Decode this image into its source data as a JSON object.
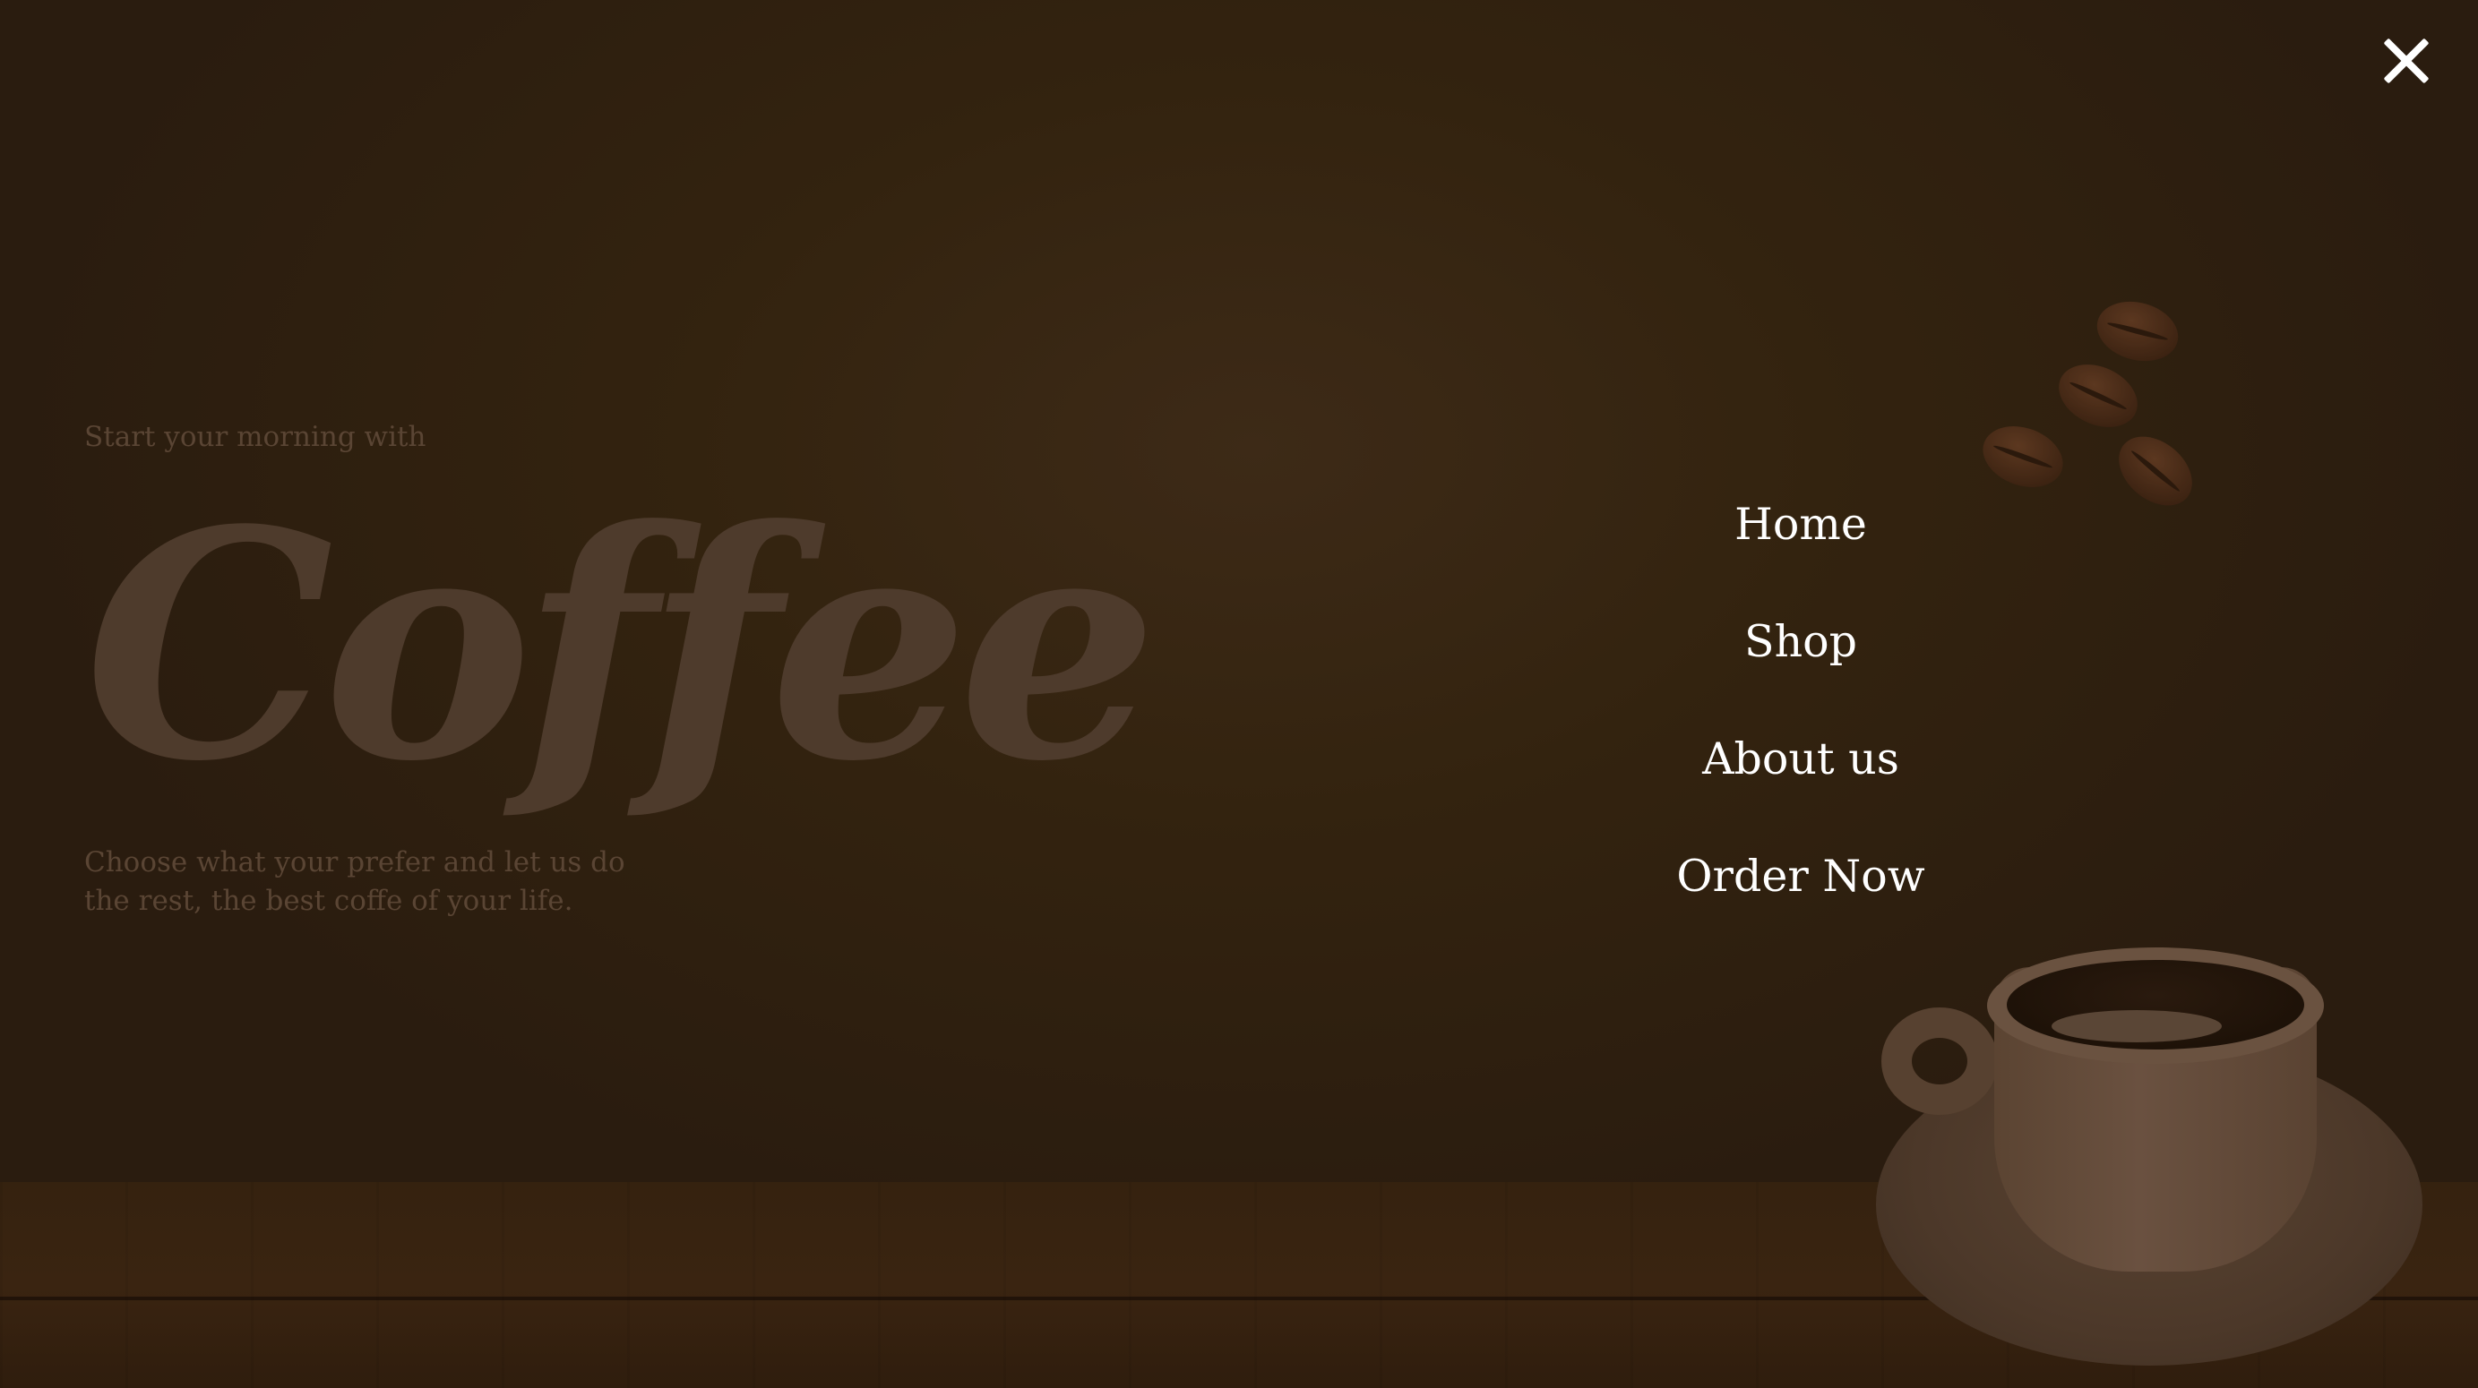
{
  "hero": {
    "kicker": "Start your morning with",
    "title": "Coffee",
    "description": "Choose what your prefer and let us do the rest, the best coffe of your life."
  },
  "nav": {
    "items": [
      {
        "label": "Home"
      },
      {
        "label": "Shop"
      },
      {
        "label": "About us"
      },
      {
        "label": "Order Now"
      }
    ]
  },
  "close": {
    "icon": "close-icon"
  },
  "colors": {
    "overlay": "#2e1f12",
    "nav_text": "#ffffff",
    "hero_text": "#5a4534"
  }
}
